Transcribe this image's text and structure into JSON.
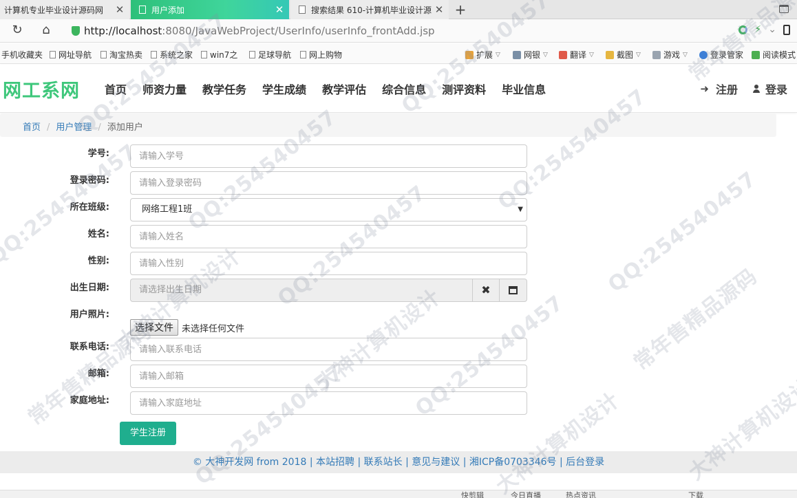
{
  "browser": {
    "tabs": [
      {
        "title": "计算机专业毕业设计源码网",
        "active": false
      },
      {
        "title": "用户添加",
        "active": true
      },
      {
        "title": "搜索结果 610-计算机毕业设计源",
        "active": false
      }
    ],
    "url_host": "http://localhost",
    "url_path": ":8080/JavaWebProject/UserInfo/userInfo_frontAdd.jsp",
    "bookmarks": [
      "手机收藏夹",
      "网址导航",
      "淘宝热卖",
      "系统之家",
      "win7之",
      "足球导航",
      "网上购物"
    ],
    "toolbar_items": [
      "扩展",
      "网银",
      "翻译",
      "截图",
      "游戏",
      "登录管家",
      "阅读模式"
    ]
  },
  "site": {
    "logo": "网工系网",
    "nav": [
      "首页",
      "师资力量",
      "教学任务",
      "学生成绩",
      "教学评估",
      "综合信息",
      "测评资料",
      "毕业信息"
    ],
    "register": "注册",
    "login": "登录"
  },
  "breadcrumb": {
    "home": "首页",
    "section": "用户管理",
    "current": "添加用户"
  },
  "form": {
    "student_id": {
      "label": "学号:",
      "placeholder": "请输入学号"
    },
    "password": {
      "label": "登录密码:",
      "placeholder": "请输入登录密码"
    },
    "class": {
      "label": "所在班级:",
      "value": "网络工程1班"
    },
    "name": {
      "label": "姓名:",
      "placeholder": "请输入姓名"
    },
    "gender": {
      "label": "性别:",
      "placeholder": "请输入性别"
    },
    "birth": {
      "label": "出生日期:",
      "placeholder": "请选择出生日期"
    },
    "photo": {
      "label": "用户照片:",
      "button": "选择文件",
      "status": "未选择任何文件"
    },
    "phone": {
      "label": "联系电话:",
      "placeholder": "请输入联系电话"
    },
    "email": {
      "label": "邮箱:",
      "placeholder": "请输入邮箱"
    },
    "address": {
      "label": "家庭地址:",
      "placeholder": "请输入家庭地址"
    },
    "submit": "学生注册"
  },
  "footer": "© 大神开发网 from 2018 | 本站招聘 | 联系站长 | 意见与建议 | 湘ICP备0703346号 | 后台登录",
  "status_bar": [
    "快剪辑",
    "今日直播",
    "热点资讯",
    "下载"
  ],
  "watermarks": [
    "QQ:254540457",
    "常年售精品源码",
    "大神计算机设计"
  ],
  "colors": {
    "brand": "#3ec77b",
    "active_tab": "#2ec07a",
    "submit": "#1fae8e",
    "link": "#337ab7"
  }
}
